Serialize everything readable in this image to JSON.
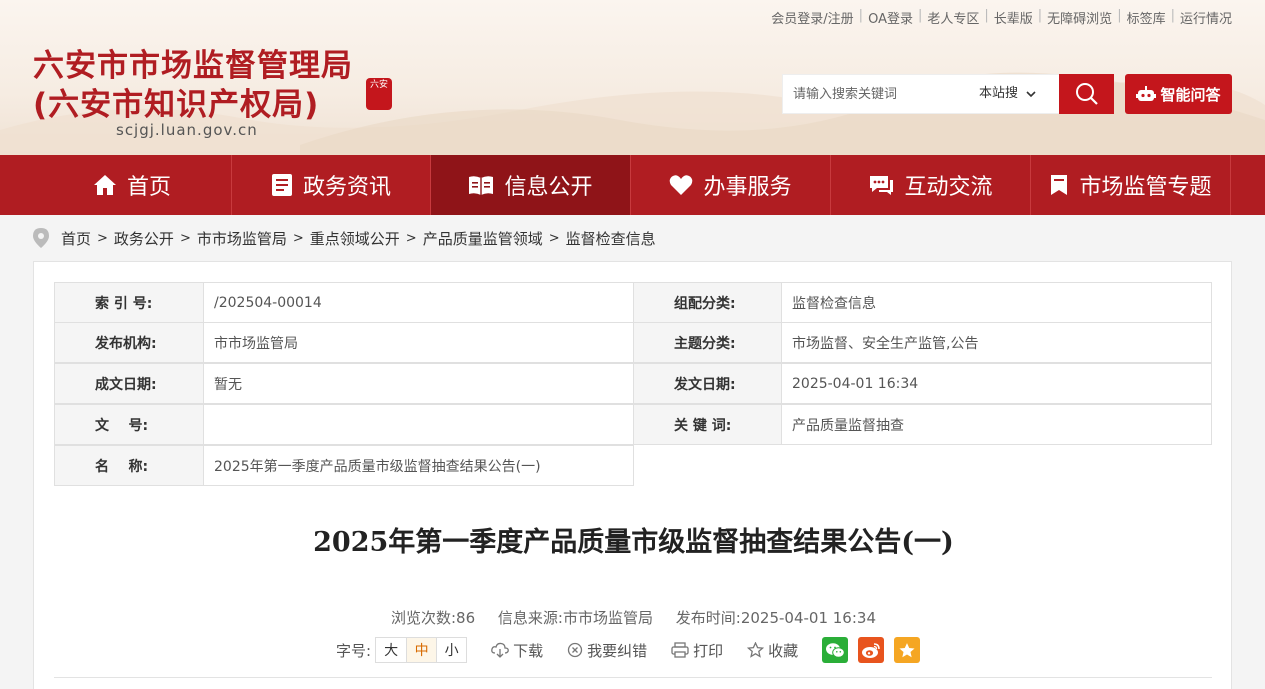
{
  "header": {
    "top_links": [
      "会员登录/注册",
      "OA登录",
      "老人专区",
      "长辈版",
      "无障碍浏览",
      "标签库",
      "运行情况"
    ],
    "title_line1": "六安市市场监督管理局",
    "title_line2": "(六安市知识产权局)",
    "domain": "scjgj.luan.gov.cn",
    "seal_text": "六安",
    "search_placeholder": "请输入搜索关键词",
    "search_scope": "本站搜",
    "ai_button": "智能问答"
  },
  "nav": {
    "items": [
      {
        "label": "首页",
        "icon": "home-icon"
      },
      {
        "label": "政务资讯",
        "icon": "news-icon"
      },
      {
        "label": "信息公开",
        "icon": "open-book-icon"
      },
      {
        "label": "办事服务",
        "icon": "heart-icon"
      },
      {
        "label": "互动交流",
        "icon": "chat-icon"
      },
      {
        "label": "市场监管专题",
        "icon": "bookmark-icon"
      }
    ],
    "active": "信息公开"
  },
  "breadcrumb": [
    "首页",
    "政务公开",
    "市市场监管局",
    "重点领域公开",
    "产品质量监管领域",
    "监督检查信息"
  ],
  "meta": {
    "index_label": "索 引 号:",
    "index_value": "/202504-00014",
    "category_label": "组配分类:",
    "category_value": "监督检查信息",
    "publisher_label": "发布机构:",
    "publisher_value": "市市场监管局",
    "topic_label": "主题分类:",
    "topic_value": "市场监督、安全生产监管,公告",
    "created_label": "成文日期:",
    "created_value": "暂无",
    "issued_label": "发文日期:",
    "issued_value": "2025-04-01 16:34",
    "docno_label": "文    号:",
    "docno_value": "",
    "keywords_label": "关 键 词:",
    "keywords_value": "产品质量监督抽查",
    "name_label": "名    称:",
    "name_value": "2025年第一季度产品质量市级监督抽查结果公告(一)"
  },
  "article": {
    "title": "2025年第一季度产品质量市级监督抽查结果公告(一)",
    "views": "浏览次数:86",
    "source": "信息来源:市市场监管局",
    "published": "发布时间:2025-04-01 16:34"
  },
  "tools": {
    "font_label": "字号:",
    "font_sizes": [
      "大",
      "中",
      "小"
    ],
    "download": "下载",
    "report_error": "我要纠错",
    "print": "打印",
    "favorite": "收藏"
  },
  "colors": {
    "brand_red": "#b01d22",
    "nav_active": "#8f1418",
    "wechat_green": "#2aae38",
    "weibo_orange": "#e8541e",
    "favorite_orange": "#f5a623"
  }
}
